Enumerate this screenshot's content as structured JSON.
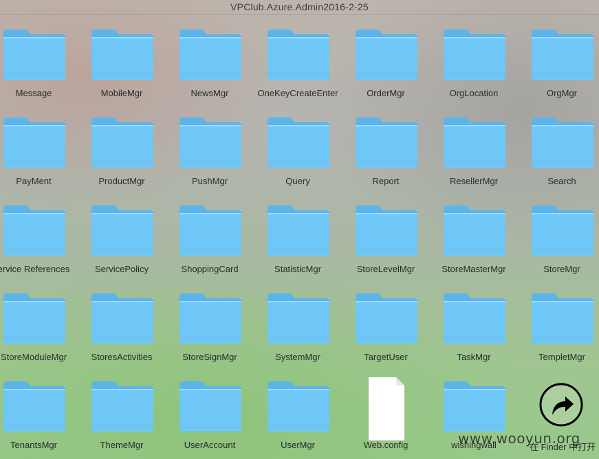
{
  "window": {
    "title": "VPClub.Azure.Admin2016-2-25"
  },
  "items": [
    {
      "label": "Message",
      "kind": "folder"
    },
    {
      "label": "MobileMgr",
      "kind": "folder"
    },
    {
      "label": "NewsMgr",
      "kind": "folder"
    },
    {
      "label": "OneKeyCreateEnter",
      "kind": "folder"
    },
    {
      "label": "OrderMgr",
      "kind": "folder"
    },
    {
      "label": "OrgLocation",
      "kind": "folder"
    },
    {
      "label": "OrgMgr",
      "kind": "folder"
    },
    {
      "label": "PayMent",
      "kind": "folder"
    },
    {
      "label": "ProductMgr",
      "kind": "folder"
    },
    {
      "label": "PushMgr",
      "kind": "folder"
    },
    {
      "label": "Query",
      "kind": "folder"
    },
    {
      "label": "Report",
      "kind": "folder"
    },
    {
      "label": "ResellerMgr",
      "kind": "folder"
    },
    {
      "label": "Search",
      "kind": "folder"
    },
    {
      "label": "ervice References",
      "kind": "folder"
    },
    {
      "label": "ServicePolicy",
      "kind": "folder"
    },
    {
      "label": "ShoppingCard",
      "kind": "folder"
    },
    {
      "label": "StatisticMgr",
      "kind": "folder"
    },
    {
      "label": "StoreLevelMgr",
      "kind": "folder"
    },
    {
      "label": "StoreMasterMgr",
      "kind": "folder"
    },
    {
      "label": "StoreMgr",
      "kind": "folder"
    },
    {
      "label": "StoreModuleMgr",
      "kind": "folder"
    },
    {
      "label": "StoresActivities",
      "kind": "folder"
    },
    {
      "label": "StoreSignMgr",
      "kind": "folder"
    },
    {
      "label": "SystemMgr",
      "kind": "folder"
    },
    {
      "label": "TargetUser",
      "kind": "folder"
    },
    {
      "label": "TaskMgr",
      "kind": "folder"
    },
    {
      "label": "TempletMgr",
      "kind": "folder"
    },
    {
      "label": "TenantsMgr",
      "kind": "folder"
    },
    {
      "label": "ThemeMgr",
      "kind": "folder"
    },
    {
      "label": "UserAccount",
      "kind": "folder"
    },
    {
      "label": "UserMgr",
      "kind": "folder"
    },
    {
      "label": "Web.config",
      "kind": "file"
    },
    {
      "label": "wishingwall",
      "kind": "folder"
    }
  ],
  "finder": {
    "label": "在 Finder 中打开",
    "icon": "share-arrow-icon"
  },
  "watermark": {
    "text": "www.wooyun.org"
  },
  "colors": {
    "folder_front": "#6fc7f7",
    "folder_back": "#5ab6ea",
    "file_page": "#ffffff"
  }
}
